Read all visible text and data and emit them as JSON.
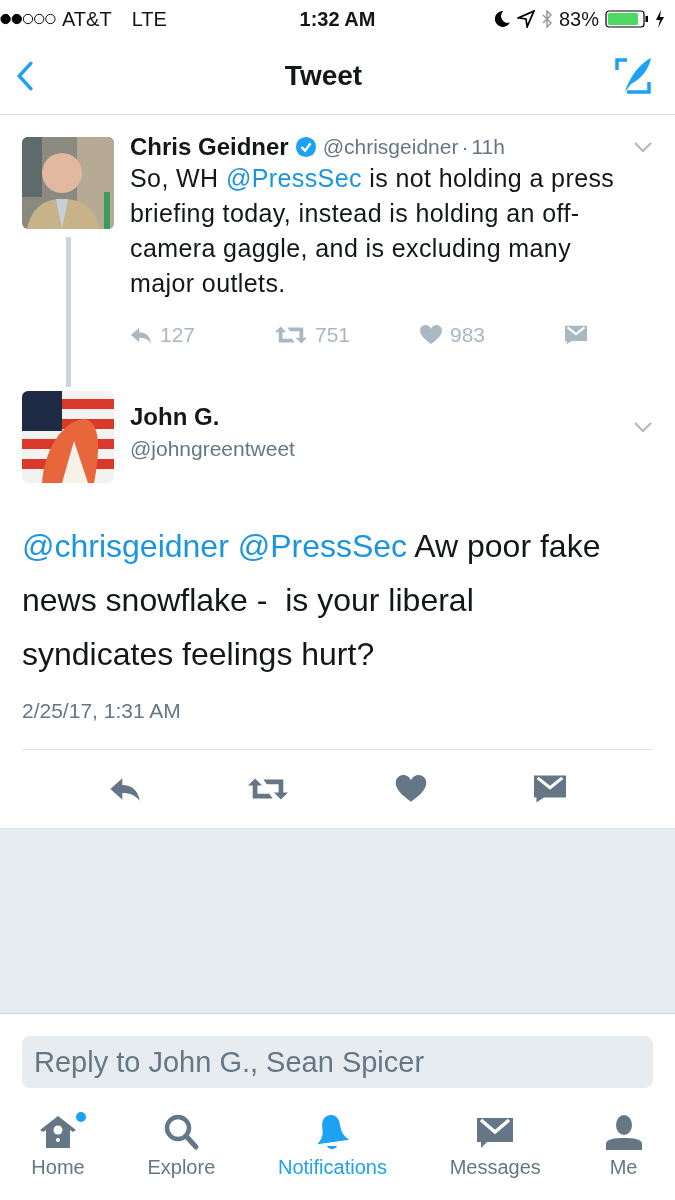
{
  "status_bar": {
    "carrier": "AT&T",
    "network": "LTE",
    "time": "1:32 AM",
    "battery_text": "83%"
  },
  "nav": {
    "title": "Tweet"
  },
  "parent_tweet": {
    "name": "Chris Geidner",
    "verified": true,
    "handle": "@chrisgeidner",
    "separator": "·",
    "age": "11h",
    "text": [
      {
        "kind": "plain",
        "text": "So, WH "
      },
      {
        "kind": "mention",
        "text": "@PressSec"
      },
      {
        "kind": "plain",
        "text": " is not holding a press briefing today, instead is holding an off-camera gaggle, and is excluding many major outlets."
      }
    ],
    "actions": [
      {
        "kind": "reply",
        "count": "127"
      },
      {
        "kind": "retweet",
        "count": "751"
      },
      {
        "kind": "like",
        "count": "983"
      },
      {
        "kind": "message"
      }
    ]
  },
  "tweet": {
    "name": "John G.",
    "handle": "@johngreentweet",
    "mentions": [
      "@chrisgeidner",
      "@PressSec"
    ],
    "body": "Aw poor fake news snowflake -  is your liberal syndicates feelings hurt?",
    "timestamp": "2/25/17, 1:31 AM",
    "actions": [
      {
        "kind": "reply"
      },
      {
        "kind": "retweet"
      },
      {
        "kind": "like"
      },
      {
        "kind": "message"
      }
    ]
  },
  "reply_field": {
    "placeholder": "Reply to John G., Sean Spicer"
  },
  "tab_bar": [
    {
      "kind": "home",
      "label": "Home",
      "selected": false,
      "badge": true
    },
    {
      "kind": "explore",
      "label": "Explore",
      "selected": false,
      "badge": false
    },
    {
      "kind": "notifications",
      "label": "Notifications",
      "selected": true,
      "badge": false
    },
    {
      "kind": "messages",
      "label": "Messages",
      "selected": false,
      "badge": false
    },
    {
      "kind": "me",
      "label": "Me",
      "selected": false,
      "badge": false
    }
  ]
}
